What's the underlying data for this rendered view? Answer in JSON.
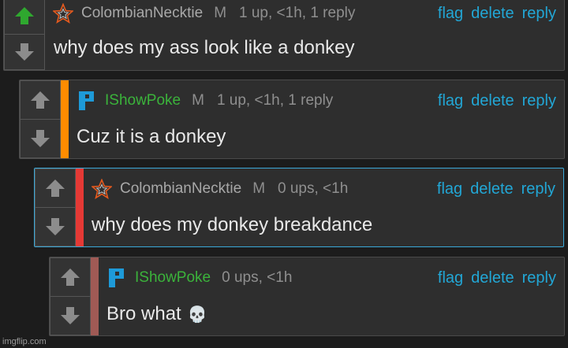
{
  "colors": {
    "background": "#1c1c1c",
    "link": "#22a7d6",
    "username_green": "#3bb33b",
    "upvoted_arrow": "#2fa82f",
    "stripe_orange": "#ff8c00",
    "stripe_red": "#e53935",
    "stripe_brown": "#a05a55"
  },
  "comments": [
    {
      "username": "ColombianNecktie",
      "gender": "M",
      "meta": "1 up, <1h, 1 reply",
      "text": "why does my ass look like a donkey",
      "avatar": "star-outline-icon",
      "upvoted": true
    },
    {
      "username": "IShowPoke",
      "gender": "M",
      "meta": "1 up, <1h, 1 reply",
      "text": "Cuz it is a donkey",
      "avatar": "blue-p-icon",
      "upvoted": false
    },
    {
      "username": "ColombianNecktie",
      "gender": "M",
      "meta": "0 ups, <1h",
      "text": "why does my donkey breakdance",
      "avatar": "star-outline-icon",
      "upvoted": false
    },
    {
      "username": "IShowPoke",
      "gender": "",
      "meta": "0 ups, <1h",
      "text": "Bro what",
      "emoji": "💀",
      "avatar": "blue-p-icon",
      "upvoted": false
    }
  ],
  "actions": {
    "flag": "flag",
    "delete": "delete",
    "reply": "reply"
  },
  "watermark": "imgflip.com"
}
